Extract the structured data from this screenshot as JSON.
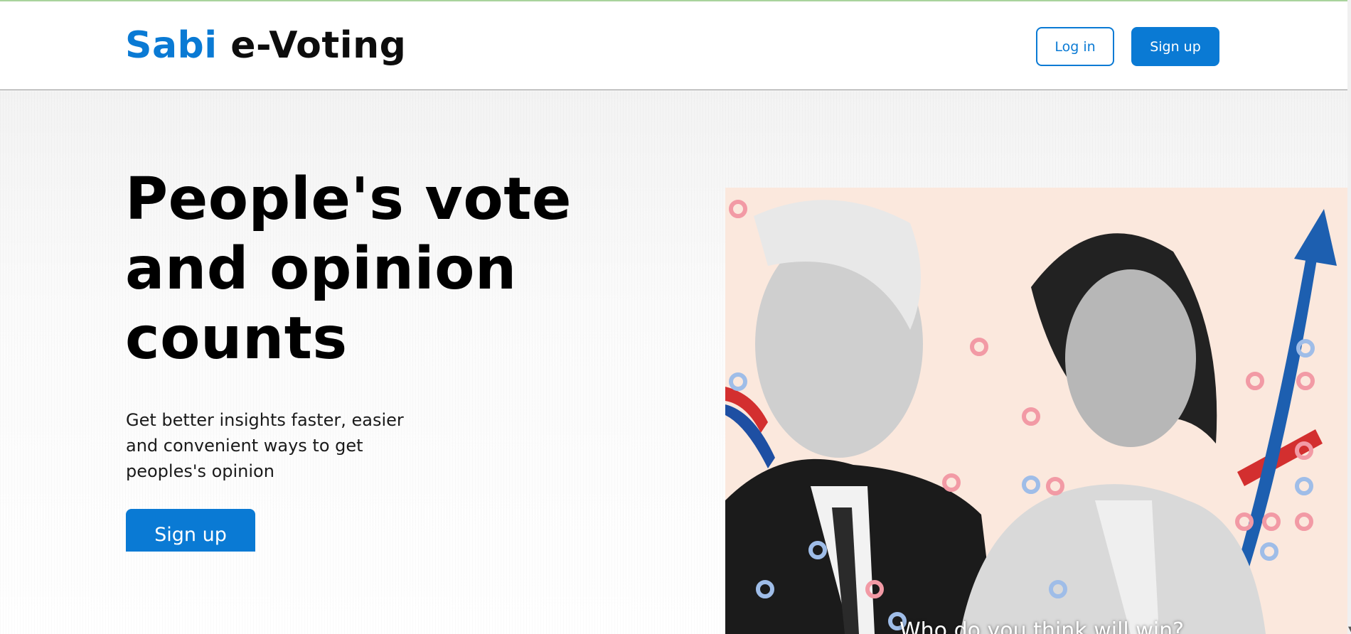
{
  "brand": {
    "accent": "Sabi",
    "rest": "e-Voting"
  },
  "nav": {
    "login_label": "Log in",
    "signup_label": "Sign up"
  },
  "hero": {
    "headline": "People's vote and opinion counts",
    "subtext": "Get better insights faster, easier and convenient ways to get peoples's opinion",
    "signup_label": "Sign up",
    "image_caption": "Who do you think will win?"
  },
  "colors": {
    "accent": "#0a7ad4",
    "image_bg": "#fbe8dd"
  },
  "icons": {
    "scroll": "scroll-down-arrow-icon"
  }
}
